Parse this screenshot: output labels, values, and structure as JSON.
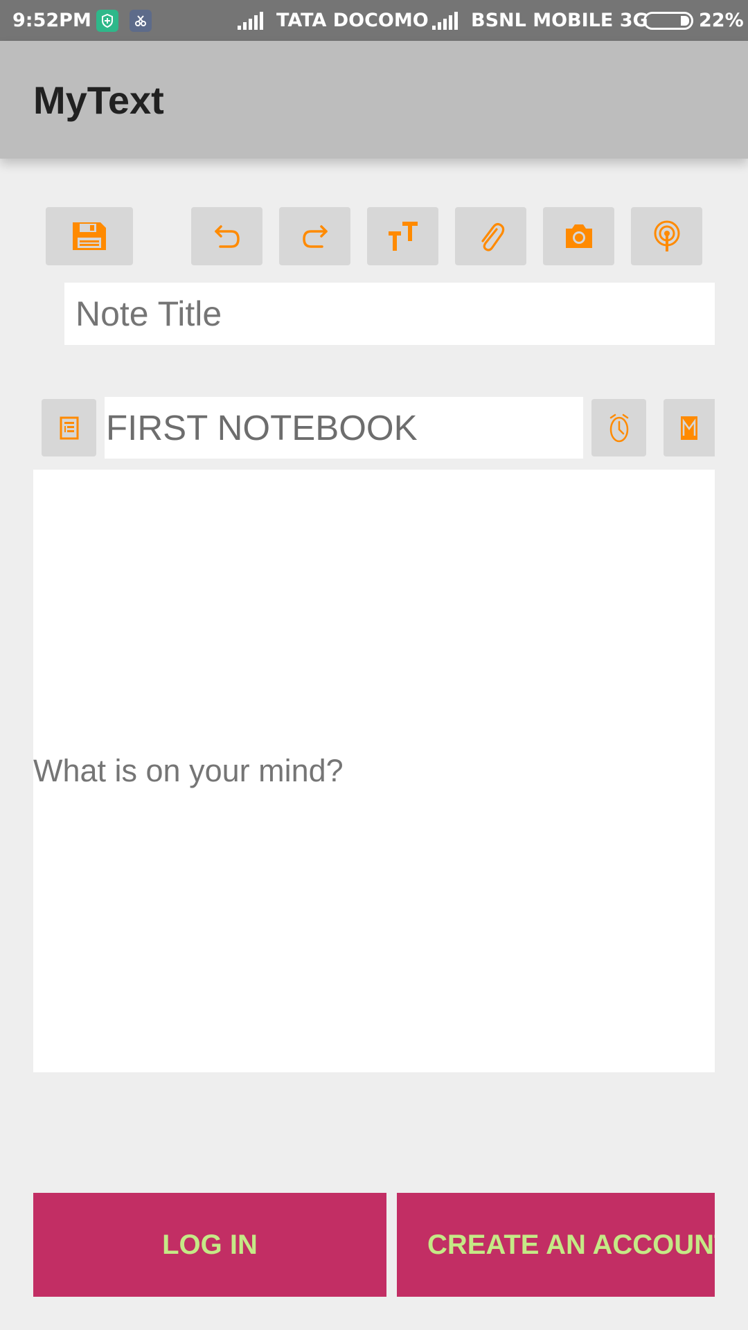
{
  "status_bar": {
    "time": "9:52PM",
    "carrier1": "TATA DOCOMO",
    "carrier2": "BSNL MOBILE 3G",
    "battery": "22%",
    "battery_level": 0.22,
    "icons": [
      "shield-icon",
      "tool-icon",
      "signal-icon",
      "signal-icon",
      "battery-icon"
    ]
  },
  "app_bar": {
    "title": "MyText"
  },
  "toolbar": {
    "accent_color": "#ff8a00",
    "buttons": [
      "save-icon",
      "undo-icon",
      "redo-icon",
      "text-size-icon",
      "attach-icon",
      "camera-icon",
      "record-icon"
    ]
  },
  "note": {
    "title_placeholder": "Note Title",
    "notebook": "FIRST NOTEBOOK",
    "body_placeholder": "What is on your mind?"
  },
  "actions": {
    "login_label": "LOG IN",
    "create_label": "CREATE AN ACCOUNT",
    "button_color": "#c22e64",
    "label_color": "#c5e986"
  }
}
